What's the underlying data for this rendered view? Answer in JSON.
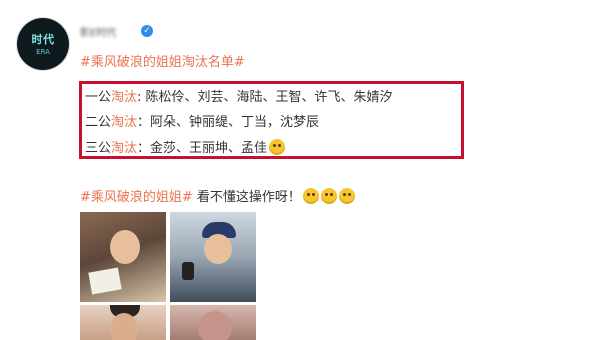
{
  "post": {
    "avatar_text": "时代",
    "avatar_sub": "ERA",
    "username": "影E时代",
    "verified_mark": "✓",
    "hashtag_title": "#乘风破浪的姐姐淘汰名单#",
    "rounds": [
      {
        "prefix": "一公",
        "keyword": "淘汰",
        "sep": ": ",
        "names": "陈松伶、刘芸、海陆、王智、许飞、朱婧汐"
      },
      {
        "prefix": "二公",
        "keyword": "淘汰",
        "sep": "：",
        "names": "阿朵、钟丽缇、丁当，沈梦辰"
      },
      {
        "prefix": "三公",
        "keyword": "淘汰",
        "sep": "：",
        "names": "金莎、王丽坤、孟佳"
      }
    ],
    "comment_hashtag": "#乘风破浪的姐姐#",
    "comment_text": " 看不懂这操作呀！"
  },
  "colors": {
    "hashtag": "#eb7350",
    "highlight_box": "#c8102e",
    "verified": "#2d8cf0"
  },
  "icons": [
    "verified-icon",
    "thinking-emoji-icon",
    "awkward-emoji-icon"
  ]
}
